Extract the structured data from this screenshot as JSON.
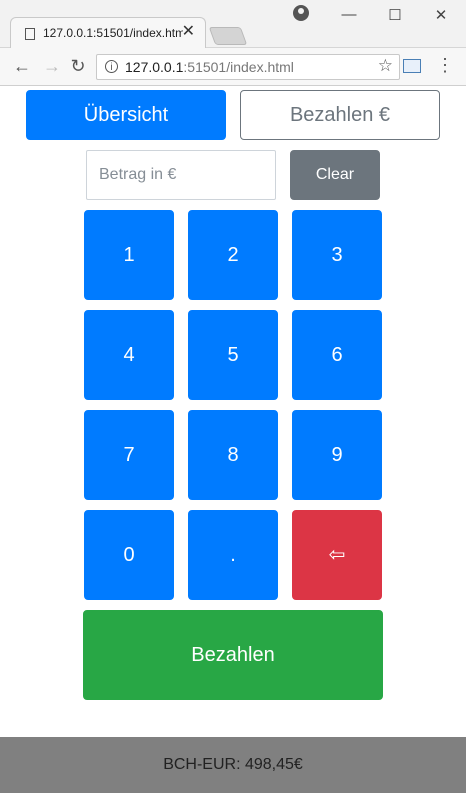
{
  "browser": {
    "tab_title": "127.0.0.1:51501/index.html",
    "url_host": "127.0.0.1",
    "url_rest": ":51501/index.html",
    "tab_close": "✕",
    "icons": [
      "page-icon",
      "user-icon",
      "minimize-icon",
      "maximize-icon",
      "close-icon",
      "back-icon",
      "forward-icon",
      "reload-icon",
      "info-icon",
      "star-icon",
      "extension-icon",
      "menu-icon"
    ]
  },
  "nav": {
    "overview_label": "Übersicht",
    "pay_label": "Bezahlen €"
  },
  "amount": {
    "placeholder": "Betrag in €",
    "value": "",
    "clear_label": "Clear"
  },
  "keypad": {
    "keys": [
      "1",
      "2",
      "3",
      "4",
      "5",
      "6",
      "7",
      "8",
      "9",
      "0",
      ".",
      "⇦"
    ]
  },
  "pay_button": "Bezahlen",
  "footer": {
    "rate": "BCH-EUR: 498,45€"
  },
  "colors": {
    "primary": "#007bff",
    "secondary": "#6c757d",
    "danger": "#dc3545",
    "success": "#28a745",
    "footer_bg": "#808080"
  }
}
